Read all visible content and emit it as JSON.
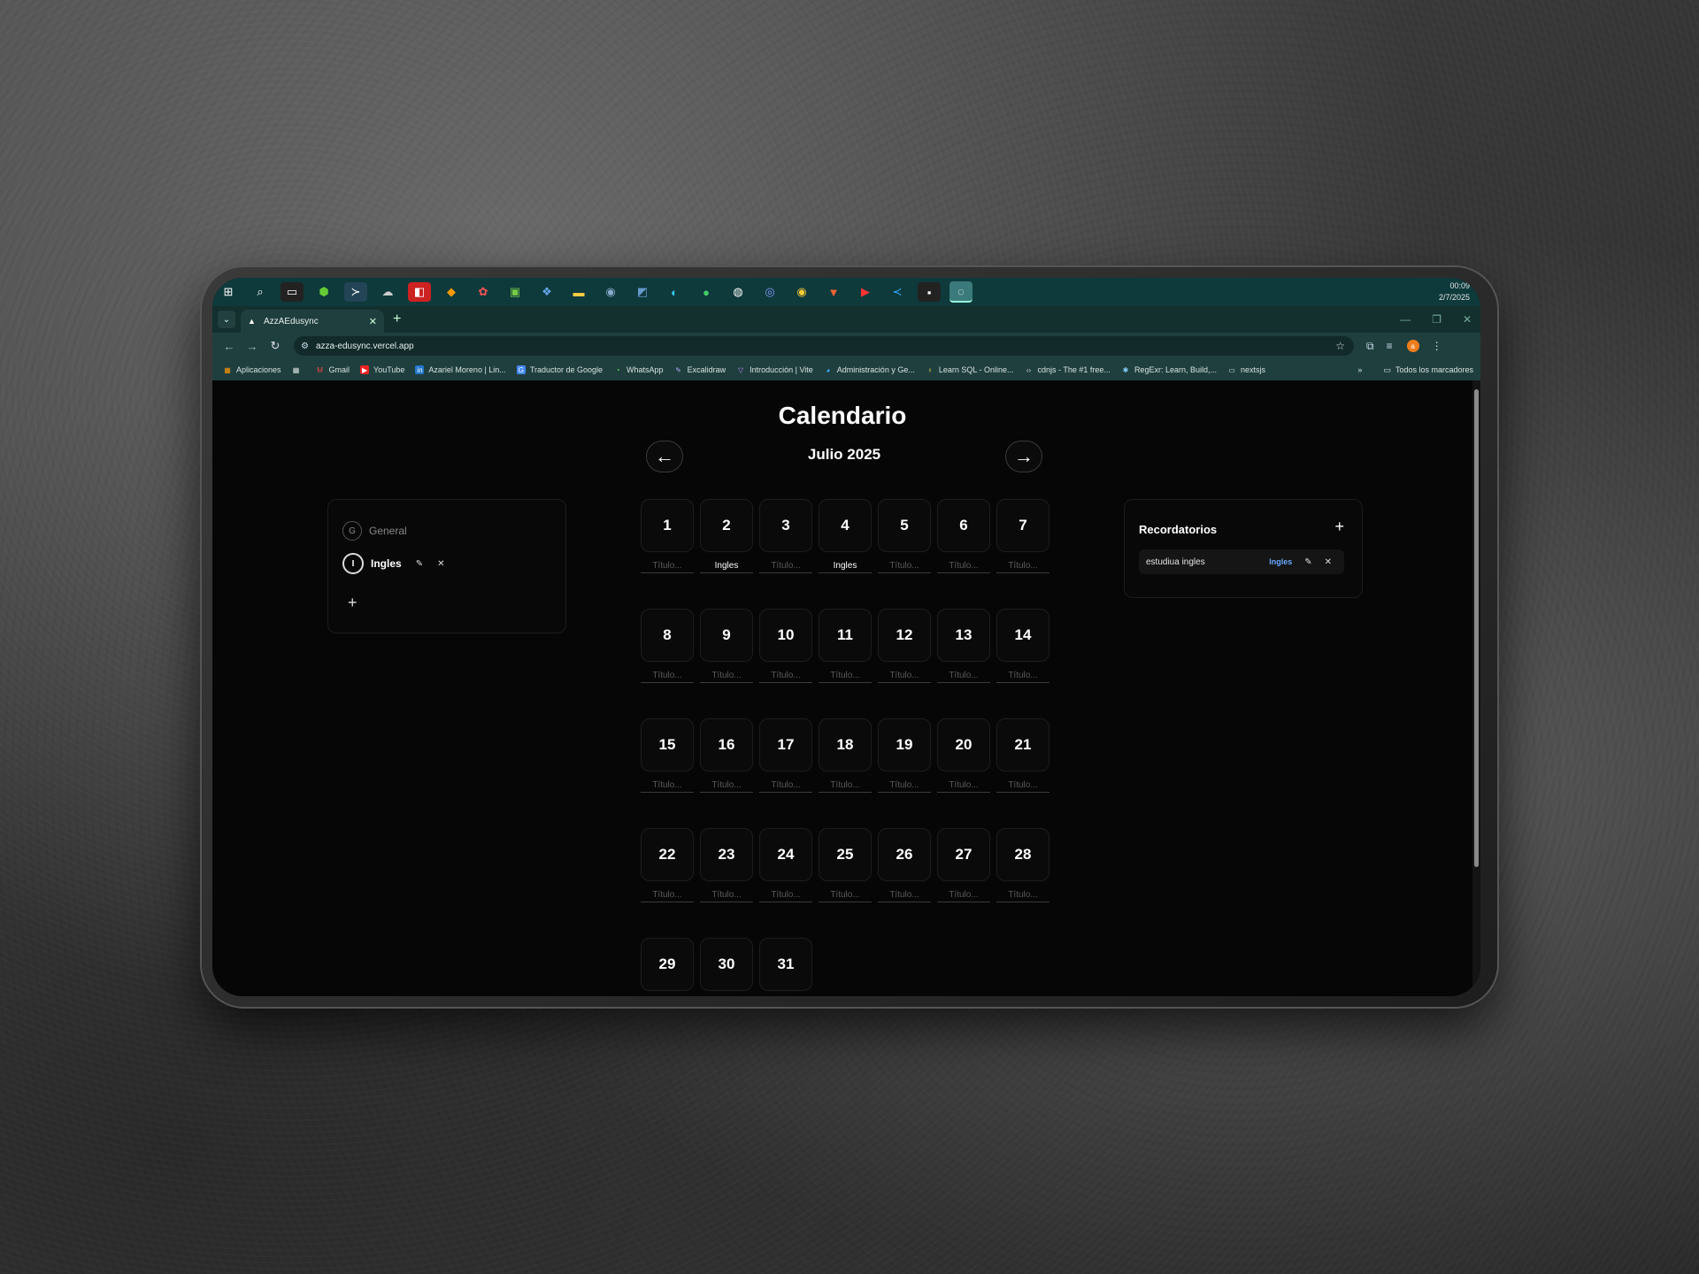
{
  "taskbar": {
    "icons": [
      "windows-start-icon",
      "search-icon",
      "terminal-icon",
      "node-icon",
      "powershell-icon",
      "cloud-icon",
      "app-red-icon",
      "git-icon",
      "figma-icon",
      "android-icon",
      "copilot-icon",
      "file-explorer-icon",
      "postgres-icon",
      "ide-icon",
      "edge-icon",
      "mongodb-icon",
      "github-icon",
      "discord-icon",
      "chrome-icon",
      "brave-icon",
      "youtube-icon",
      "vscode-icon",
      "notion-icon",
      "obs-icon"
    ],
    "time": "00:09",
    "date": "2/7/2025"
  },
  "browser": {
    "tab_title": "AzzAEdusync",
    "url": "azza-edusync.vercel.app",
    "profile_initial": "a",
    "bookmarks": [
      "Aplicaciones",
      "Gmail",
      "YouTube",
      "Azariel Moreno | Lin...",
      "Traductor de Google",
      "WhatsApp",
      "Excalidraw",
      "Introducción | Vite",
      "Administración y Ge...",
      "Learn SQL - Online...",
      "cdnjs - The #1 free...",
      "RegExr: Learn, Build,...",
      "nextsjs"
    ],
    "all_bookmarks": "Todos los marcadores"
  },
  "calendar": {
    "title": "Calendario",
    "month_label": "Julio 2025",
    "prev_symbol": "←",
    "next_symbol": "→",
    "placeholder": "Título...",
    "days": [
      "1",
      "2",
      "3",
      "4",
      "5",
      "6",
      "7",
      "8",
      "9",
      "10",
      "11",
      "12",
      "13",
      "14",
      "15",
      "16",
      "17",
      "18",
      "19",
      "20",
      "21",
      "22",
      "23",
      "24",
      "25",
      "26",
      "27",
      "28",
      "29",
      "30",
      "31"
    ],
    "filled": {
      "2": "Ingles",
      "4": "Ingles"
    }
  },
  "categories": {
    "items": [
      {
        "letter": "G",
        "name": "General",
        "selected": false
      },
      {
        "letter": "I",
        "name": "Ingles",
        "selected": true
      }
    ],
    "edit_symbol": "✎",
    "delete_symbol": "✕",
    "add_symbol": "+"
  },
  "reminders": {
    "title": "Recordatorios",
    "add_symbol": "+",
    "items": [
      {
        "text": "estudiua ingles",
        "tag": "Ingles"
      }
    ],
    "edit_symbol": "✎",
    "delete_symbol": "✕",
    "tag_color": "#6aa8ff"
  }
}
